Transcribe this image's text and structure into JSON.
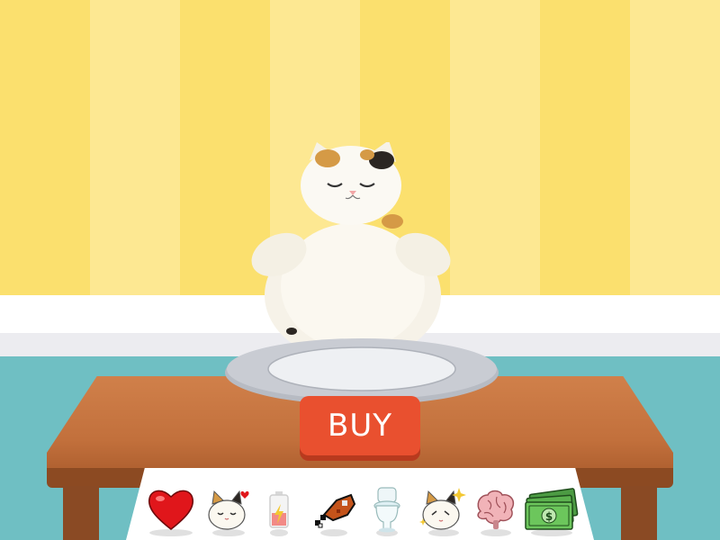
{
  "buy_button": {
    "label": "BUY"
  },
  "colors": {
    "wall_stripe_a": "#fbe06e",
    "wall_stripe_b": "#fde892",
    "floor": "#6fbfc3",
    "buy_button": "#e9502f",
    "table": "#c2703c"
  },
  "items": [
    {
      "icon": "heart-icon"
    },
    {
      "icon": "cat-love-icon"
    },
    {
      "icon": "battery-low-icon"
    },
    {
      "icon": "meat-drumstick-icon"
    },
    {
      "icon": "toilet-icon"
    },
    {
      "icon": "cat-sparkle-icon"
    },
    {
      "icon": "brain-icon"
    },
    {
      "icon": "money-icon"
    }
  ]
}
